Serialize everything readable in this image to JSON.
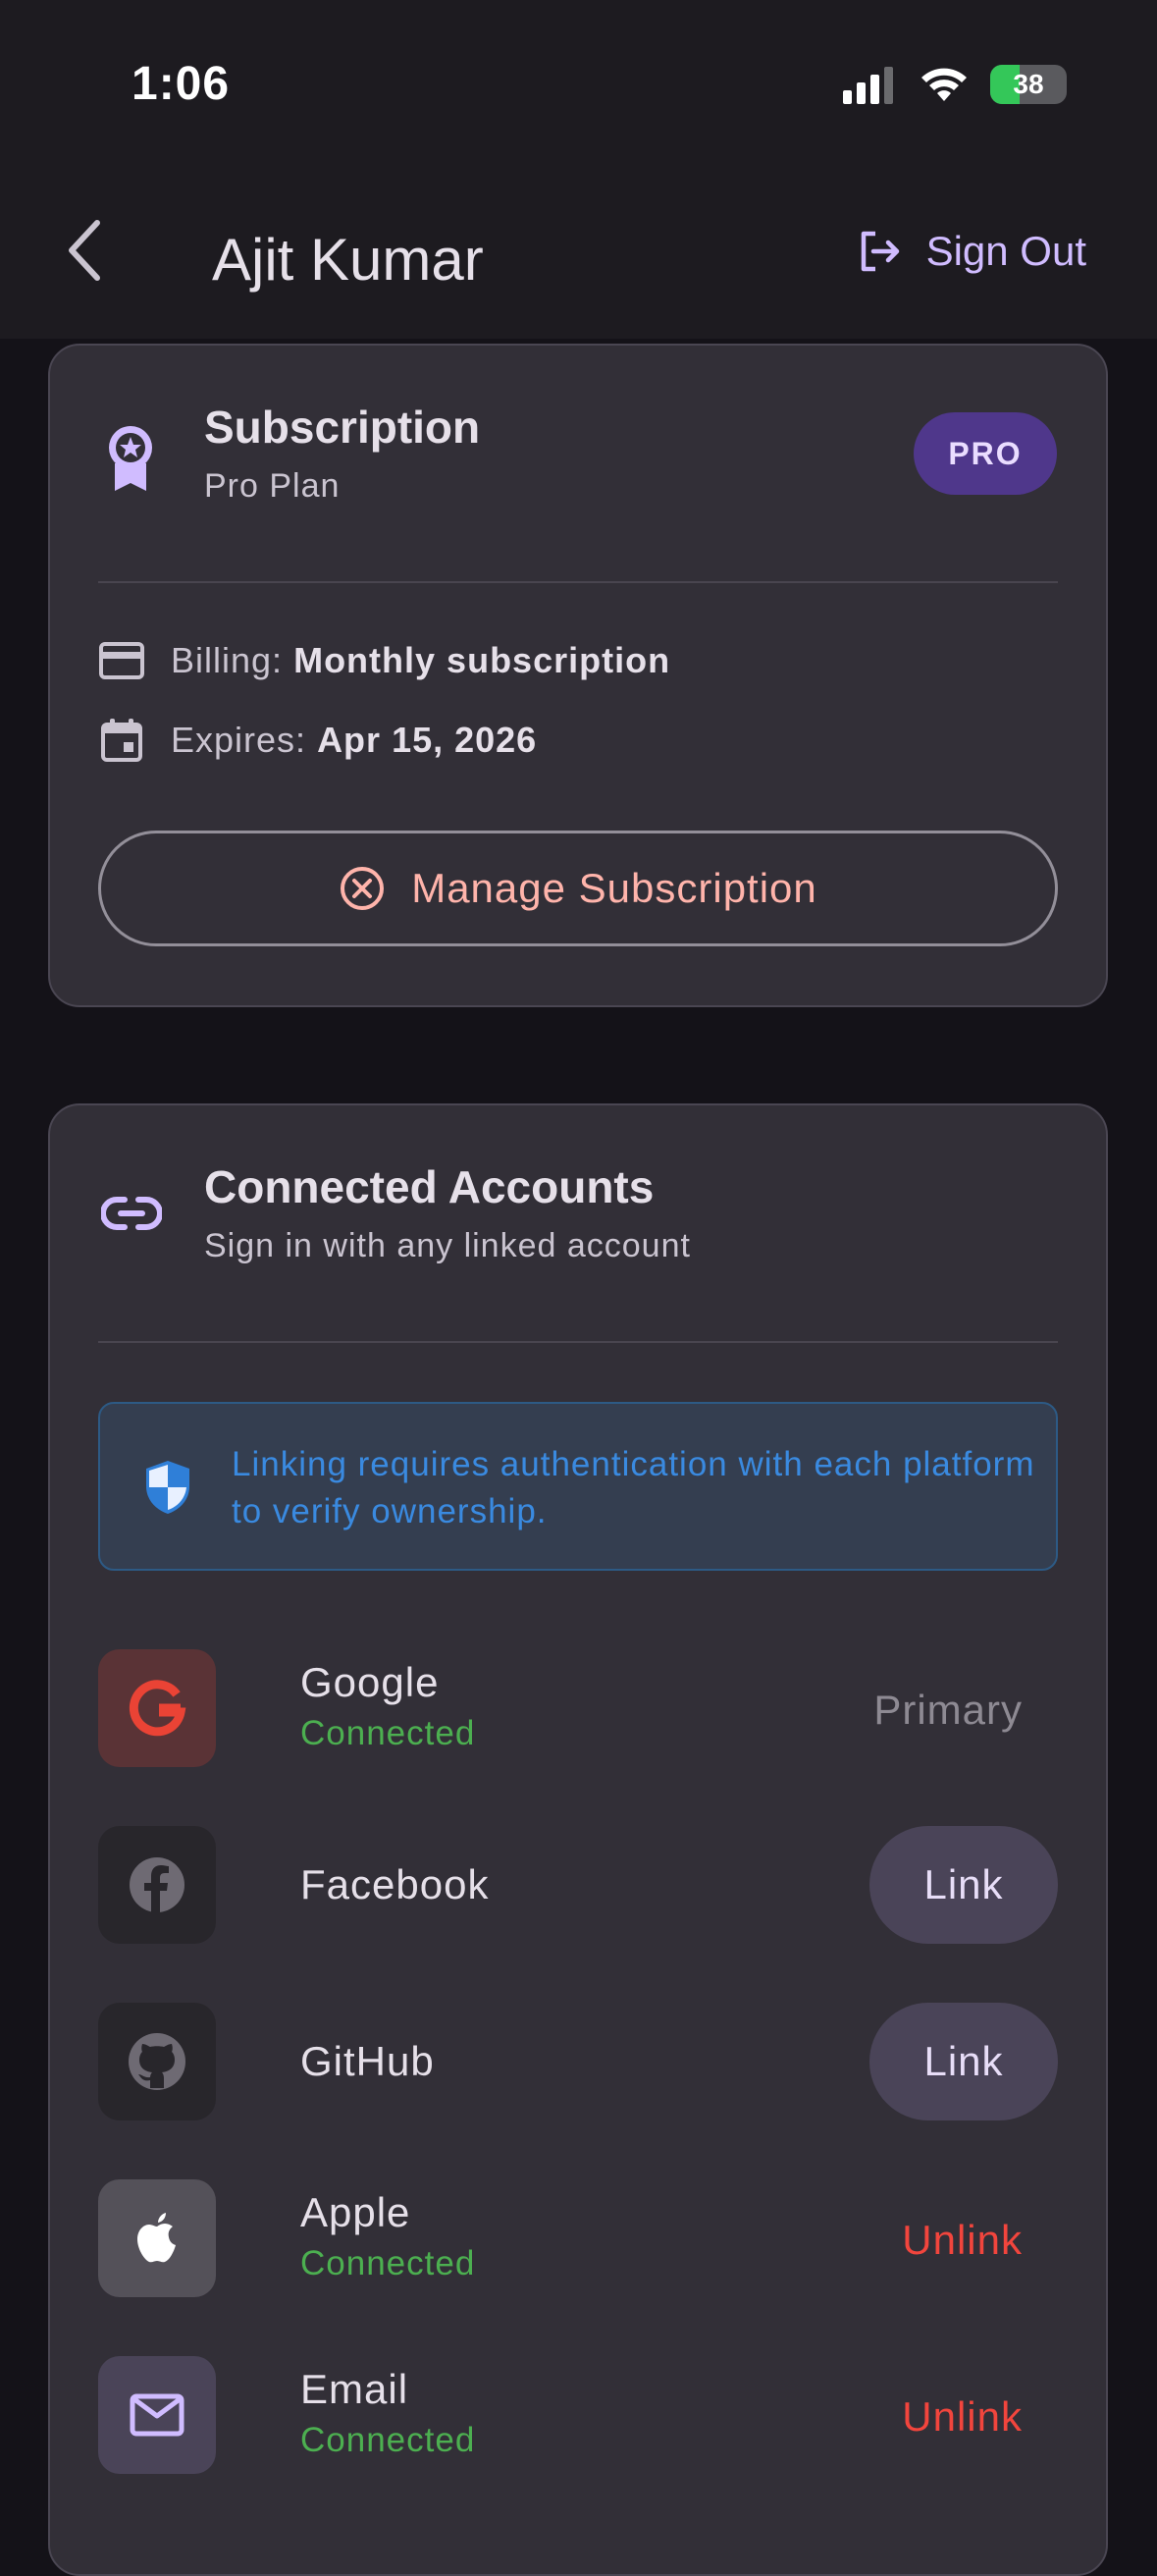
{
  "status_bar": {
    "time": "1:06",
    "battery": "38"
  },
  "app_bar": {
    "title": "Ajit Kumar",
    "sign_out": "Sign Out"
  },
  "subscription": {
    "title": "Subscription",
    "plan": "Pro Plan",
    "badge": "PRO",
    "billing_label": "Billing:",
    "billing_value": "Monthly subscription",
    "expires_label": "Expires:",
    "expires_value": "Apr 15, 2026",
    "manage_label": "Manage Subscription"
  },
  "connected": {
    "title": "Connected Accounts",
    "subtitle": "Sign in with any linked account",
    "notice": "Linking requires authentication with each platform to verify ownership.",
    "accounts": [
      {
        "name": "Google",
        "status": "Connected",
        "action": "Primary"
      },
      {
        "name": "Facebook",
        "status": "",
        "action": "Link"
      },
      {
        "name": "GitHub",
        "status": "",
        "action": "Link"
      },
      {
        "name": "Apple",
        "status": "Connected",
        "action": "Unlink"
      },
      {
        "name": "Email",
        "status": "Connected",
        "action": "Unlink"
      }
    ]
  },
  "colors": {
    "accent": "#d0bcff",
    "badge": "#4f378b",
    "danger": "#f2453d",
    "connected": "#4caf50",
    "info": "#3a8ae0"
  }
}
